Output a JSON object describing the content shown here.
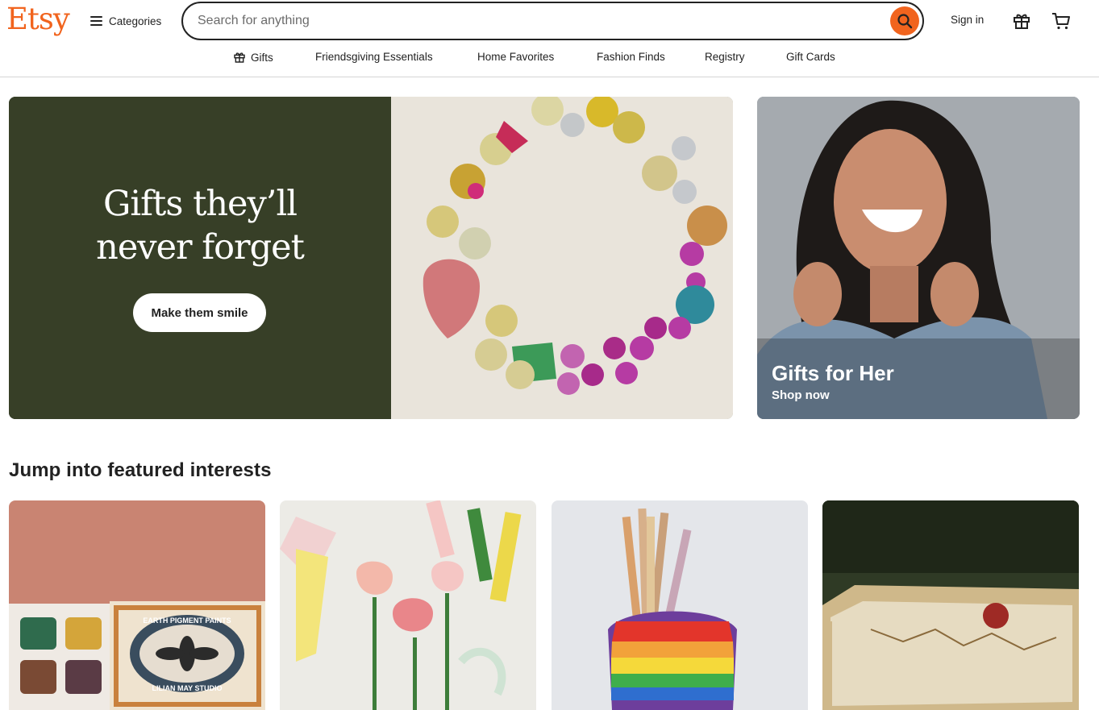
{
  "header": {
    "logo": "Etsy",
    "categories_label": "Categories",
    "search_placeholder": "Search for anything",
    "signin_label": "Sign in"
  },
  "nav": {
    "items": [
      "Gifts",
      "Friendsgiving Essentials",
      "Home Favorites",
      "Fashion Finds",
      "Registry",
      "Gift Cards"
    ]
  },
  "hero": {
    "title_line1": "Gifts they’ll",
    "title_line2": "never forget",
    "button_label": "Make them smile"
  },
  "side_card": {
    "title": "Gifts for Her",
    "subtitle": "Shop now"
  },
  "featured": {
    "title": "Jump into featured interests",
    "tile1_text": [
      "EARTH PIGMENT PAINTS",
      "LILIAN MAY STUDIO"
    ]
  },
  "colors": {
    "brand": "#f1641e",
    "hero_bg": "#373f27"
  }
}
